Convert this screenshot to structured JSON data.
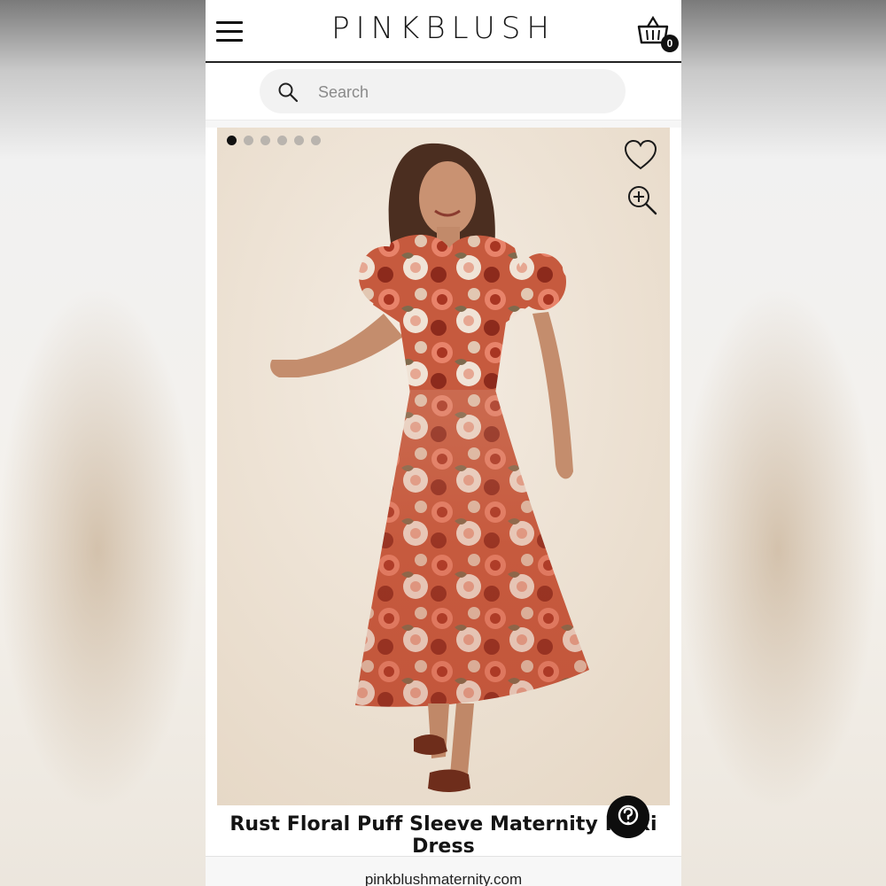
{
  "header": {
    "logo_text": "PINKBLUSH",
    "cart_count": "0",
    "menu_icon": "hamburger-menu-icon",
    "cart_icon": "shopping-basket-icon"
  },
  "search": {
    "placeholder": "Search",
    "icon": "search-icon"
  },
  "gallery": {
    "image_count": 6,
    "active_index": 0,
    "favorite_icon": "heart-outline-icon",
    "zoom_icon": "zoom-in-icon",
    "product_image": "woman-in-floral-maxi-dress-photo"
  },
  "product": {
    "title": "Rust Floral Puff Sleeve Maternity Maxi Dress"
  },
  "help": {
    "icon": "question-mark-icon"
  },
  "browser": {
    "domain": "pinkblushmaternity.com"
  },
  "colors": {
    "header_text": "#161616",
    "dress_rust": "#b8432c",
    "dress_cream": "#efe3d6",
    "background_beige": "#ede2d4"
  }
}
